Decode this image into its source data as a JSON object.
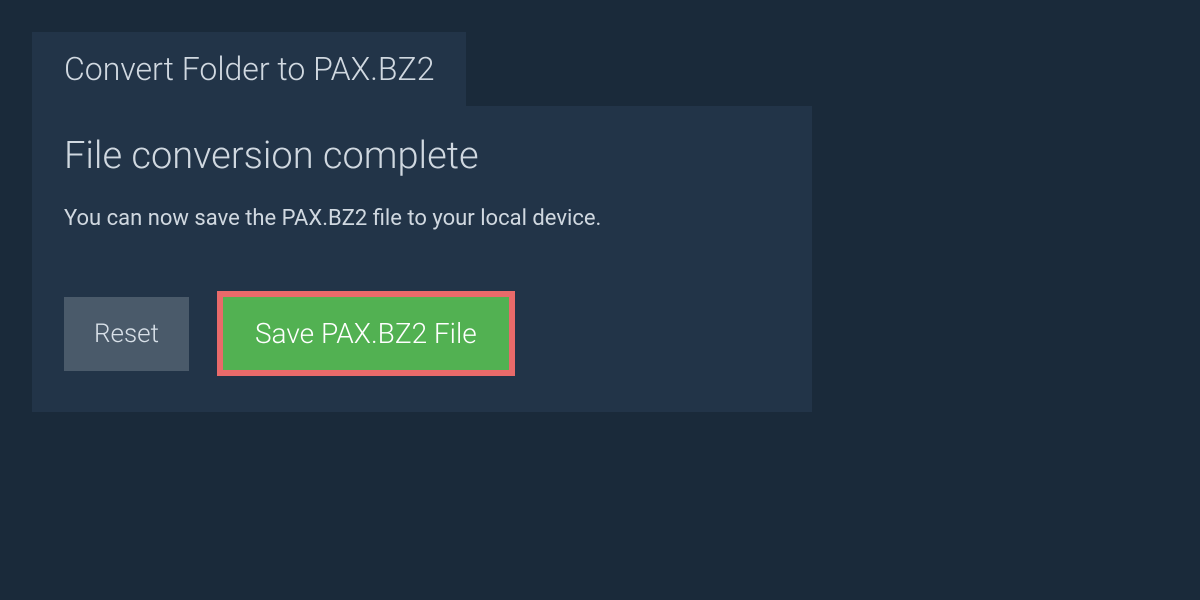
{
  "tab": {
    "label": "Convert Folder to PAX.BZ2"
  },
  "panel": {
    "heading": "File conversion complete",
    "description": "You can now save the PAX.BZ2 file to your local device."
  },
  "buttons": {
    "reset": "Reset",
    "save": "Save PAX.BZ2 File"
  }
}
